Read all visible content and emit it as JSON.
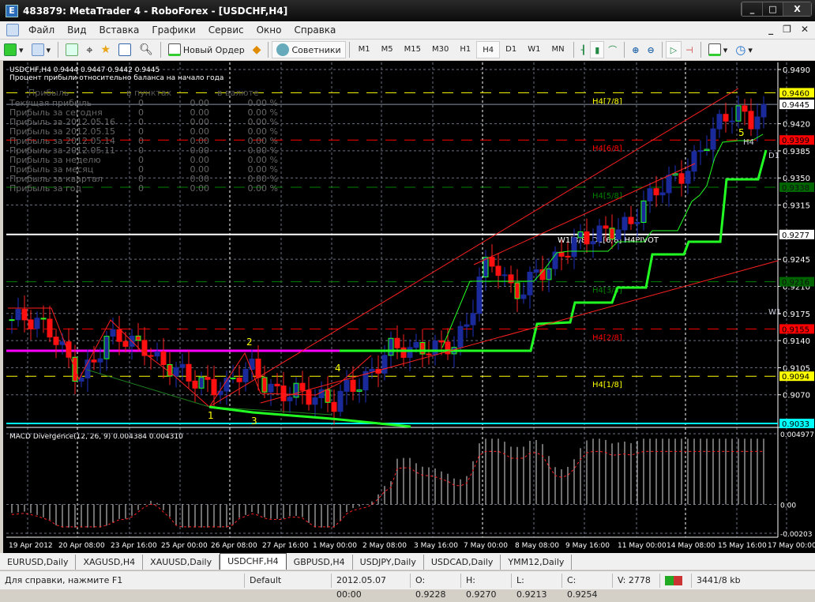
{
  "window": {
    "title": "483879: MetaTrader 4 - RoboForex - [USDCHF,H4]",
    "buttons": [
      "_",
      "□",
      "X"
    ]
  },
  "menu": [
    "Файл",
    "Вид",
    "Вставка",
    "Графики",
    "Сервис",
    "Окно",
    "Справка"
  ],
  "toolbar": {
    "new_order": "Новый Ордер",
    "experts": "Советники",
    "timeframes": [
      "M1",
      "M5",
      "M15",
      "M30",
      "H1",
      "H4",
      "D1",
      "W1",
      "MN"
    ],
    "active_tf": "H4"
  },
  "chart": {
    "header": "USDCHF,H4  0.9444 0.9447 0.9442 0.9445",
    "subtitle": "Процент прибыли относительно баланса на начало года",
    "profit_table": {
      "headers": [
        "Прибыль",
        "в пунктах",
        "в валюте"
      ],
      "rows": [
        [
          "Текущая прибыль",
          "0",
          "0.00",
          "0.00 %"
        ],
        [
          "Прибыль за сегодня",
          "0",
          "0.00",
          "0.00 %"
        ],
        [
          "Прибыль за 2012.05.16",
          "0",
          "0.00",
          "0.00 %"
        ],
        [
          "Прибыль за 2012.05.15",
          "0",
          "0.00",
          "0.00 %"
        ],
        [
          "Прибыль за 2012.05.14",
          "0",
          "0.00",
          "0.00 %"
        ],
        [
          "Прибыль за 2012.05.11",
          "0",
          "0.00",
          "0.00 %"
        ],
        [
          "Прибыль за неделю",
          "0",
          "0.00",
          "0.00 %"
        ],
        [
          "Прибыль за месяц",
          "0",
          "0.00",
          "0.00 %"
        ],
        [
          "Прибыль за квартал",
          "0",
          "0.00",
          "0.00 %"
        ],
        [
          "Прибыль за год",
          "0",
          "0.00",
          "0.00 %"
        ]
      ]
    },
    "price_ticks": [
      "0.9490",
      "0.9420",
      "0.9385",
      "0.9350",
      "0.9315",
      "0.9245",
      "0.9210",
      "0.9175",
      "0.9140",
      "0.9105",
      "0.9070"
    ],
    "levels": [
      {
        "price": 0.946,
        "label": "0.9460",
        "name": "H4[7/8]",
        "color": "#ffff00"
      },
      {
        "price": 0.9399,
        "label": "0.9399",
        "name": "H4[6/8]",
        "color": "#ff0000"
      },
      {
        "price": 0.9338,
        "label": "0.9338",
        "name": "H4[5/8]",
        "color": "#008000"
      },
      {
        "price": 0.9277,
        "label": "0.9277",
        "name": "W1[3/8] D1[6/8] H4PIVOT",
        "color": "#ffffff"
      },
      {
        "price": 0.9216,
        "label": "0.9216",
        "name": "H4[3/8]",
        "color": "#008000"
      },
      {
        "price": 0.9155,
        "label": "0.9155",
        "name": "H4[2/8]",
        "color": "#ff0000"
      },
      {
        "price": 0.9094,
        "label": "0.9094",
        "name": "H4[1/8]",
        "color": "#ffff00"
      },
      {
        "price": 0.9033,
        "label": "0.9033",
        "name": "",
        "color": "#00ffff"
      }
    ],
    "bid": {
      "price": 0.9445,
      "label": "0.9445"
    },
    "wave_labels": [
      "1",
      "2",
      "3",
      "4",
      "5"
    ],
    "line_labels": {
      "h4": "H4",
      "d1": "D1",
      "w1": "W1"
    },
    "price_path": [
      0.9167,
      0.917,
      0.9162,
      0.9151,
      0.9121,
      0.909,
      0.911,
      0.9141,
      0.9146,
      0.9136,
      0.9131,
      0.911,
      0.9105,
      0.9095,
      0.9085,
      0.908,
      0.908,
      0.91,
      0.9105,
      0.908,
      0.907,
      0.9075,
      0.907,
      0.9065,
      0.906,
      0.908,
      0.9085,
      0.91,
      0.9131,
      0.9131,
      0.9126,
      0.9131,
      0.9131,
      0.9136,
      0.9162,
      0.9233,
      0.9243,
      0.9207,
      0.9202,
      0.9228,
      0.9233,
      0.9253,
      0.9269,
      0.9274,
      0.9279,
      0.9284,
      0.9289,
      0.9315,
      0.9335,
      0.9345,
      0.9355,
      0.9376,
      0.9406,
      0.9427,
      0.9437,
      0.9422,
      0.9445
    ],
    "macd": {
      "label": "MACD Divergence(12, 26, 9) 0.004384 0.004310",
      "ticks": [
        "0.004977",
        "0.00",
        "-0.00203"
      ],
      "max": 0.004977,
      "min": -0.00203
    }
  },
  "time_axis": [
    "19 Apr 2012",
    "20 Apr 08:00",
    "23 Apr 16:00",
    "25 Apr 00:00",
    "26 Apr 08:00",
    "27 Apr 16:00",
    "1 May 00:00",
    "2 May 08:00",
    "3 May 16:00",
    "7 May 00:00",
    "8 May 08:00",
    "9 May 16:00",
    "11 May 00:00",
    "14 May 08:00",
    "15 May 16:00",
    "17 May 00:00"
  ],
  "tabs": [
    "EURUSD,Daily",
    "XAGUSD,H4",
    "XAUUSD,Daily",
    "USDCHF,H4",
    "GBPUSD,H4",
    "USDJPY,Daily",
    "USDCAD,Daily",
    "YMM12,Daily"
  ],
  "active_tab": "USDCHF,H4",
  "status": {
    "help": "Для справки, нажмите F1",
    "profile": "Default",
    "time": "2012.05.07 00:00",
    "open": "O: 0.9228",
    "high": "H: 0.9270",
    "low": "L: 0.9213",
    "close": "C: 0.9254",
    "volume": "V: 2778",
    "traffic": "3441/8 kb"
  }
}
